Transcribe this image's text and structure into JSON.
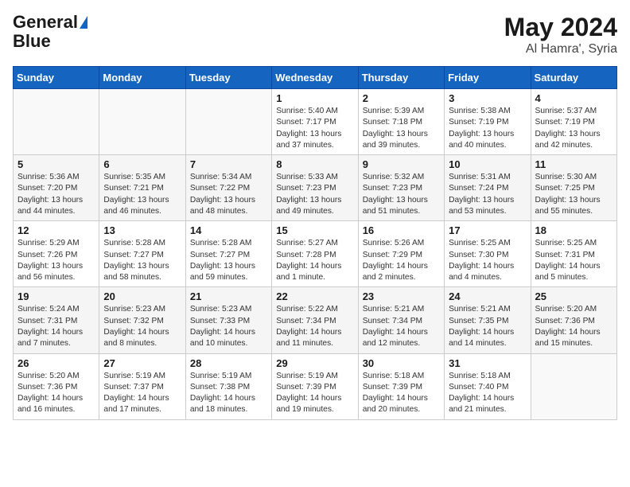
{
  "header": {
    "logo_general": "General",
    "logo_blue": "Blue",
    "month_year": "May 2024",
    "location": "Al Hamra', Syria"
  },
  "weekdays": [
    "Sunday",
    "Monday",
    "Tuesday",
    "Wednesday",
    "Thursday",
    "Friday",
    "Saturday"
  ],
  "weeks": [
    [
      {
        "day": "",
        "info": ""
      },
      {
        "day": "",
        "info": ""
      },
      {
        "day": "",
        "info": ""
      },
      {
        "day": "1",
        "info": "Sunrise: 5:40 AM\nSunset: 7:17 PM\nDaylight: 13 hours and 37 minutes."
      },
      {
        "day": "2",
        "info": "Sunrise: 5:39 AM\nSunset: 7:18 PM\nDaylight: 13 hours and 39 minutes."
      },
      {
        "day": "3",
        "info": "Sunrise: 5:38 AM\nSunset: 7:19 PM\nDaylight: 13 hours and 40 minutes."
      },
      {
        "day": "4",
        "info": "Sunrise: 5:37 AM\nSunset: 7:19 PM\nDaylight: 13 hours and 42 minutes."
      }
    ],
    [
      {
        "day": "5",
        "info": "Sunrise: 5:36 AM\nSunset: 7:20 PM\nDaylight: 13 hours and 44 minutes."
      },
      {
        "day": "6",
        "info": "Sunrise: 5:35 AM\nSunset: 7:21 PM\nDaylight: 13 hours and 46 minutes."
      },
      {
        "day": "7",
        "info": "Sunrise: 5:34 AM\nSunset: 7:22 PM\nDaylight: 13 hours and 48 minutes."
      },
      {
        "day": "8",
        "info": "Sunrise: 5:33 AM\nSunset: 7:23 PM\nDaylight: 13 hours and 49 minutes."
      },
      {
        "day": "9",
        "info": "Sunrise: 5:32 AM\nSunset: 7:23 PM\nDaylight: 13 hours and 51 minutes."
      },
      {
        "day": "10",
        "info": "Sunrise: 5:31 AM\nSunset: 7:24 PM\nDaylight: 13 hours and 53 minutes."
      },
      {
        "day": "11",
        "info": "Sunrise: 5:30 AM\nSunset: 7:25 PM\nDaylight: 13 hours and 55 minutes."
      }
    ],
    [
      {
        "day": "12",
        "info": "Sunrise: 5:29 AM\nSunset: 7:26 PM\nDaylight: 13 hours and 56 minutes."
      },
      {
        "day": "13",
        "info": "Sunrise: 5:28 AM\nSunset: 7:27 PM\nDaylight: 13 hours and 58 minutes."
      },
      {
        "day": "14",
        "info": "Sunrise: 5:28 AM\nSunset: 7:27 PM\nDaylight: 13 hours and 59 minutes."
      },
      {
        "day": "15",
        "info": "Sunrise: 5:27 AM\nSunset: 7:28 PM\nDaylight: 14 hours and 1 minute."
      },
      {
        "day": "16",
        "info": "Sunrise: 5:26 AM\nSunset: 7:29 PM\nDaylight: 14 hours and 2 minutes."
      },
      {
        "day": "17",
        "info": "Sunrise: 5:25 AM\nSunset: 7:30 PM\nDaylight: 14 hours and 4 minutes."
      },
      {
        "day": "18",
        "info": "Sunrise: 5:25 AM\nSunset: 7:31 PM\nDaylight: 14 hours and 5 minutes."
      }
    ],
    [
      {
        "day": "19",
        "info": "Sunrise: 5:24 AM\nSunset: 7:31 PM\nDaylight: 14 hours and 7 minutes."
      },
      {
        "day": "20",
        "info": "Sunrise: 5:23 AM\nSunset: 7:32 PM\nDaylight: 14 hours and 8 minutes."
      },
      {
        "day": "21",
        "info": "Sunrise: 5:23 AM\nSunset: 7:33 PM\nDaylight: 14 hours and 10 minutes."
      },
      {
        "day": "22",
        "info": "Sunrise: 5:22 AM\nSunset: 7:34 PM\nDaylight: 14 hours and 11 minutes."
      },
      {
        "day": "23",
        "info": "Sunrise: 5:21 AM\nSunset: 7:34 PM\nDaylight: 14 hours and 12 minutes."
      },
      {
        "day": "24",
        "info": "Sunrise: 5:21 AM\nSunset: 7:35 PM\nDaylight: 14 hours and 14 minutes."
      },
      {
        "day": "25",
        "info": "Sunrise: 5:20 AM\nSunset: 7:36 PM\nDaylight: 14 hours and 15 minutes."
      }
    ],
    [
      {
        "day": "26",
        "info": "Sunrise: 5:20 AM\nSunset: 7:36 PM\nDaylight: 14 hours and 16 minutes."
      },
      {
        "day": "27",
        "info": "Sunrise: 5:19 AM\nSunset: 7:37 PM\nDaylight: 14 hours and 17 minutes."
      },
      {
        "day": "28",
        "info": "Sunrise: 5:19 AM\nSunset: 7:38 PM\nDaylight: 14 hours and 18 minutes."
      },
      {
        "day": "29",
        "info": "Sunrise: 5:19 AM\nSunset: 7:39 PM\nDaylight: 14 hours and 19 minutes."
      },
      {
        "day": "30",
        "info": "Sunrise: 5:18 AM\nSunset: 7:39 PM\nDaylight: 14 hours and 20 minutes."
      },
      {
        "day": "31",
        "info": "Sunrise: 5:18 AM\nSunset: 7:40 PM\nDaylight: 14 hours and 21 minutes."
      },
      {
        "day": "",
        "info": ""
      }
    ]
  ]
}
